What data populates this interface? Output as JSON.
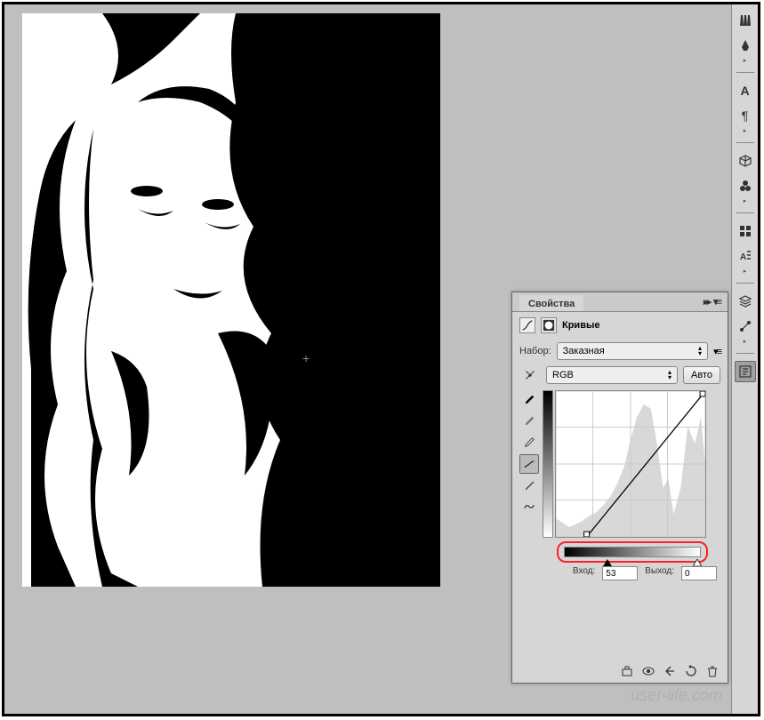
{
  "panel": {
    "tab_title": "Свойства",
    "title": "Кривые",
    "preset_label": "Набор:",
    "preset_value": "Заказная",
    "channel_value": "RGB",
    "auto_label": "Авто",
    "input_label": "Вход:",
    "input_value": "53",
    "output_label": "Выход:",
    "output_value": "0"
  },
  "toolbar": {
    "items": [
      "brushes",
      "palette",
      "type",
      "paragraph",
      "3d",
      "materials",
      "swatches",
      "character-styles",
      "layers",
      "paths",
      "properties"
    ]
  },
  "watermark": "user-life.com",
  "chart_data": {
    "type": "line",
    "title": "Curves",
    "xlabel": "Input",
    "ylabel": "Output",
    "xlim": [
      0,
      255
    ],
    "ylim": [
      0,
      255
    ],
    "points": [
      {
        "x": 53,
        "y": 0
      },
      {
        "x": 255,
        "y": 255
      }
    ],
    "black_point_input": 53,
    "white_point_input": 255,
    "output_at_black": 0
  }
}
